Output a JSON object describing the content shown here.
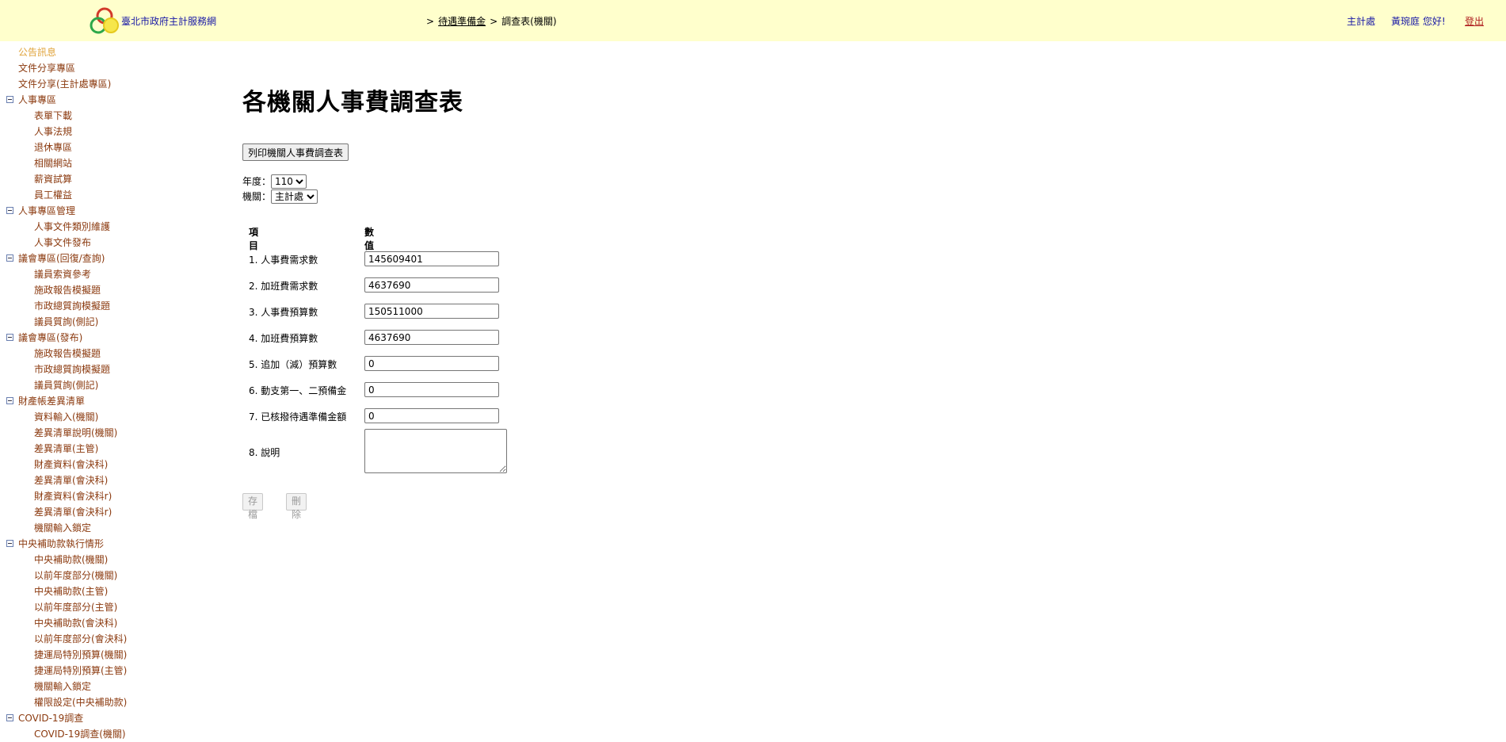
{
  "header": {
    "site_title": "臺北市政府主計服務網",
    "breadcrumb": [
      ">",
      "待遇準備金",
      ">",
      "調查表(機關)"
    ],
    "org_link": "主計處",
    "greeting": "黃琬庭 您好!",
    "logout": "登出"
  },
  "sidebar": {
    "items": [
      {
        "label": "公告訊息",
        "level": 0,
        "toggle": false,
        "active": true
      },
      {
        "label": "文件分享專區",
        "level": 0,
        "toggle": false
      },
      {
        "label": "文件分享(主計處專區)",
        "level": 0,
        "toggle": false
      },
      {
        "label": "人事專區",
        "level": 0,
        "toggle": true
      },
      {
        "label": "表單下載",
        "level": 1
      },
      {
        "label": "人事法規",
        "level": 1
      },
      {
        "label": "退休專區",
        "level": 1
      },
      {
        "label": "相關網站",
        "level": 1
      },
      {
        "label": "薪資試算",
        "level": 1
      },
      {
        "label": "員工權益",
        "level": 1
      },
      {
        "label": "人事專區管理",
        "level": 0,
        "toggle": true
      },
      {
        "label": "人事文件類別維護",
        "level": 1
      },
      {
        "label": "人事文件發布",
        "level": 1
      },
      {
        "label": "議會專區(回復/查詢)",
        "level": 0,
        "toggle": true
      },
      {
        "label": "議員索資參考",
        "level": 1
      },
      {
        "label": "施政報告模擬題",
        "level": 1
      },
      {
        "label": "市政總質詢模擬題",
        "level": 1
      },
      {
        "label": "議員質詢(側記)",
        "level": 1
      },
      {
        "label": "議會專區(發布)",
        "level": 0,
        "toggle": true
      },
      {
        "label": "施政報告模擬題",
        "level": 1
      },
      {
        "label": "市政總質詢模擬題",
        "level": 1
      },
      {
        "label": "議員質詢(側記)",
        "level": 1
      },
      {
        "label": "財產帳差異清單",
        "level": 0,
        "toggle": true
      },
      {
        "label": "資料輸入(機關)",
        "level": 1
      },
      {
        "label": "差異清單說明(機關)",
        "level": 1
      },
      {
        "label": "差異清單(主管)",
        "level": 1
      },
      {
        "label": "財產資料(會決科)",
        "level": 1
      },
      {
        "label": "差異清單(會決科)",
        "level": 1
      },
      {
        "label": "財產資料(會決科r)",
        "level": 1
      },
      {
        "label": "差異清單(會決科r)",
        "level": 1
      },
      {
        "label": "機關輸入鎖定",
        "level": 1
      },
      {
        "label": "中央補助款執行情形",
        "level": 0,
        "toggle": true
      },
      {
        "label": "中央補助款(機關)",
        "level": 1
      },
      {
        "label": "以前年度部分(機關)",
        "level": 1
      },
      {
        "label": "中央補助款(主管)",
        "level": 1
      },
      {
        "label": "以前年度部分(主管)",
        "level": 1
      },
      {
        "label": "中央補助款(會決科)",
        "level": 1
      },
      {
        "label": "以前年度部分(會決科)",
        "level": 1
      },
      {
        "label": "捷運局特別預算(機關)",
        "level": 1
      },
      {
        "label": "捷運局特別預算(主管)",
        "level": 1
      },
      {
        "label": "機關輸入鎖定",
        "level": 1
      },
      {
        "label": "權限設定(中央補助款)",
        "level": 1
      },
      {
        "label": "COVID-19調查",
        "level": 0,
        "toggle": true
      },
      {
        "label": "COVID-19調查(機關)",
        "level": 1
      }
    ]
  },
  "main": {
    "title": "各機關人事費調查表",
    "print_button": "列印機關人事費調查表",
    "year_label": "年度：",
    "year_value": "110",
    "agency_label": "機關：",
    "agency_value": "主計處",
    "col_item": "項目",
    "col_value": "數值",
    "rows": [
      {
        "label": "1. 人事費需求數",
        "value": "145609401"
      },
      {
        "label": "2. 加班費需求數",
        "value": "4637690"
      },
      {
        "label": "3. 人事費預算數",
        "value": "150511000"
      },
      {
        "label": "4. 加班費預算數",
        "value": "4637690"
      },
      {
        "label": "5. 追加（減）預算數",
        "value": "0"
      },
      {
        "label": "6. 動支第一、二預備金",
        "value": "0"
      },
      {
        "label": "7. 已核撥待遇準備金額",
        "value": "0"
      }
    ],
    "note_label": "8. 說明",
    "note_value": "",
    "save_button": "存檔",
    "delete_button": "刪除"
  }
}
